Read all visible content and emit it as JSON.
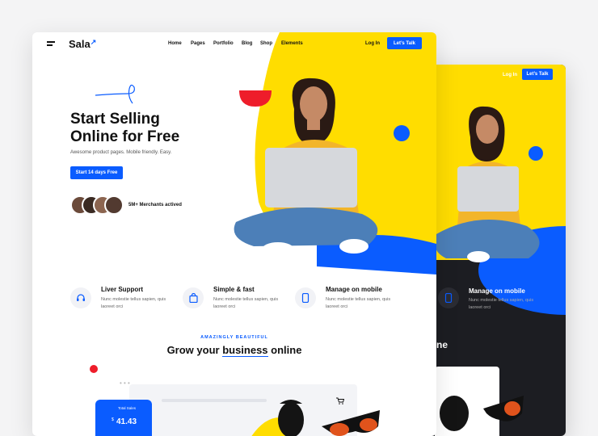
{
  "brand": {
    "name": "Sala",
    "arrow": "↗"
  },
  "nav": {
    "items": [
      "Home",
      "Pages",
      "Portfolio",
      "Blog",
      "Shop",
      "Elements"
    ],
    "login": "Log In",
    "cta": "Let’s Talk"
  },
  "hero": {
    "title_line1": "Start Selling",
    "title_line2": "Online for Free",
    "subtitle": "Awesome product pages. Mobile friendly. Easy.",
    "cta": "Start 14 days Free",
    "merchants": "5M+ Merchants actived"
  },
  "features": [
    {
      "title": "Liver Support",
      "desc": "Nunc molestie tellus sapien, quis laoreet orci",
      "icon": "headset-icon"
    },
    {
      "title": "Simple & fast",
      "desc": "Nunc molestie tellus sapien, quis laoreet orci",
      "icon": "shopping-bag-icon"
    },
    {
      "title": "Manage on mobile",
      "desc": "Nunc molestie tellus sapien, quis laoreet orci",
      "icon": "mobile-icon"
    }
  ],
  "section": {
    "eyebrow": "AMAZINGLY BEAUTIFUL",
    "title_pre": "Grow your ",
    "title_highlight": "business",
    "title_post": " online"
  },
  "mobile_widget": {
    "label": "Total Sales",
    "value": "41.43",
    "currency": "$"
  },
  "back_card": {
    "login": "Log In",
    "cta": "Let’s Talk",
    "feature_title": "Manage on mobile",
    "feature_desc": "Nunc molestie tellus sapien, quis laoreet orci",
    "section_fragment": "ne"
  },
  "colors": {
    "accent": "#0a5cff",
    "yellow": "#ffdd00",
    "red": "#ee1d2a",
    "dark": "#1c1d22"
  }
}
